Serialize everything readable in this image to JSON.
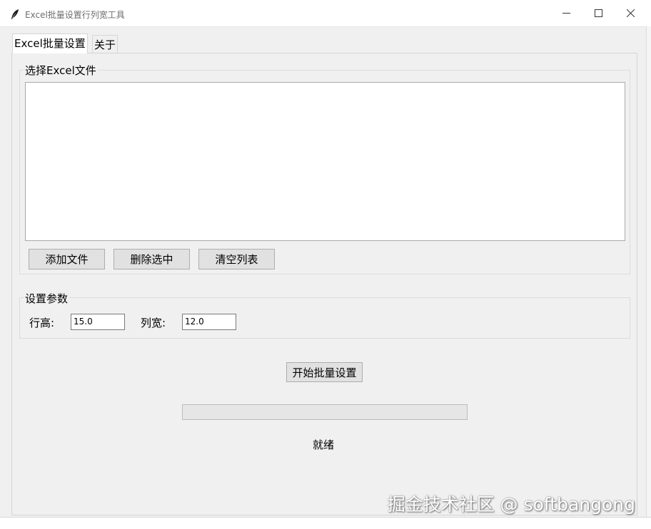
{
  "window": {
    "title": "Excel批量设置行列宽工具"
  },
  "tabs": [
    {
      "label": "Excel批量设置",
      "active": true
    },
    {
      "label": "关于",
      "active": false
    }
  ],
  "file_group": {
    "title": "选择Excel文件",
    "files": [],
    "buttons": {
      "add": "添加文件",
      "delete": "删除选中",
      "clear": "清空列表"
    }
  },
  "params_group": {
    "title": "设置参数",
    "row_height_label": "行高:",
    "row_height_value": "15.0",
    "col_width_label": "列宽:",
    "col_width_value": "12.0"
  },
  "start_button": "开始批量设置",
  "progress": 0,
  "status": "就绪",
  "watermark": "掘金技术社区 @ softbangong",
  "colors": {
    "titlebar": "#ffffff",
    "client": "#f0f0f0",
    "button": "#e1e1e1",
    "progress_fill": "#06b025"
  }
}
